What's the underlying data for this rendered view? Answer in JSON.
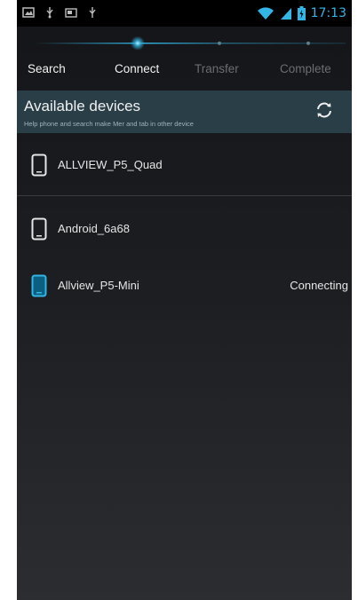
{
  "status_bar": {
    "time": "17:13",
    "icons_left": [
      "image-notification-icon",
      "usb-icon",
      "screenshot-icon",
      "usb-icon"
    ],
    "icons_right": [
      "wifi-icon",
      "signal-icon",
      "battery-icon"
    ],
    "accent_color": "#33b5e5"
  },
  "steps": {
    "items": [
      {
        "label": "Search",
        "active": true
      },
      {
        "label": "Connect",
        "active": true
      },
      {
        "label": "Transfer",
        "active": false
      },
      {
        "label": "Complete",
        "active": false
      }
    ],
    "current_index": 1
  },
  "header": {
    "title": "Available devices",
    "hint": "Help phone and search make Mer and tab in other device",
    "refresh_icon": "refresh-icon"
  },
  "devices": [
    {
      "name": "ALLVIEW_P5_Quad",
      "state": "",
      "highlight": false
    },
    {
      "name": "Android_6a68",
      "state": "",
      "highlight": false
    },
    {
      "name": "Allview_P5-Mini",
      "state": "Connecting",
      "highlight": true
    }
  ],
  "colors": {
    "accent": "#33b5e5",
    "header_bg": "#2a3e47",
    "device_icon": "#e6e6e6",
    "device_icon_active": "#33b5e5"
  }
}
